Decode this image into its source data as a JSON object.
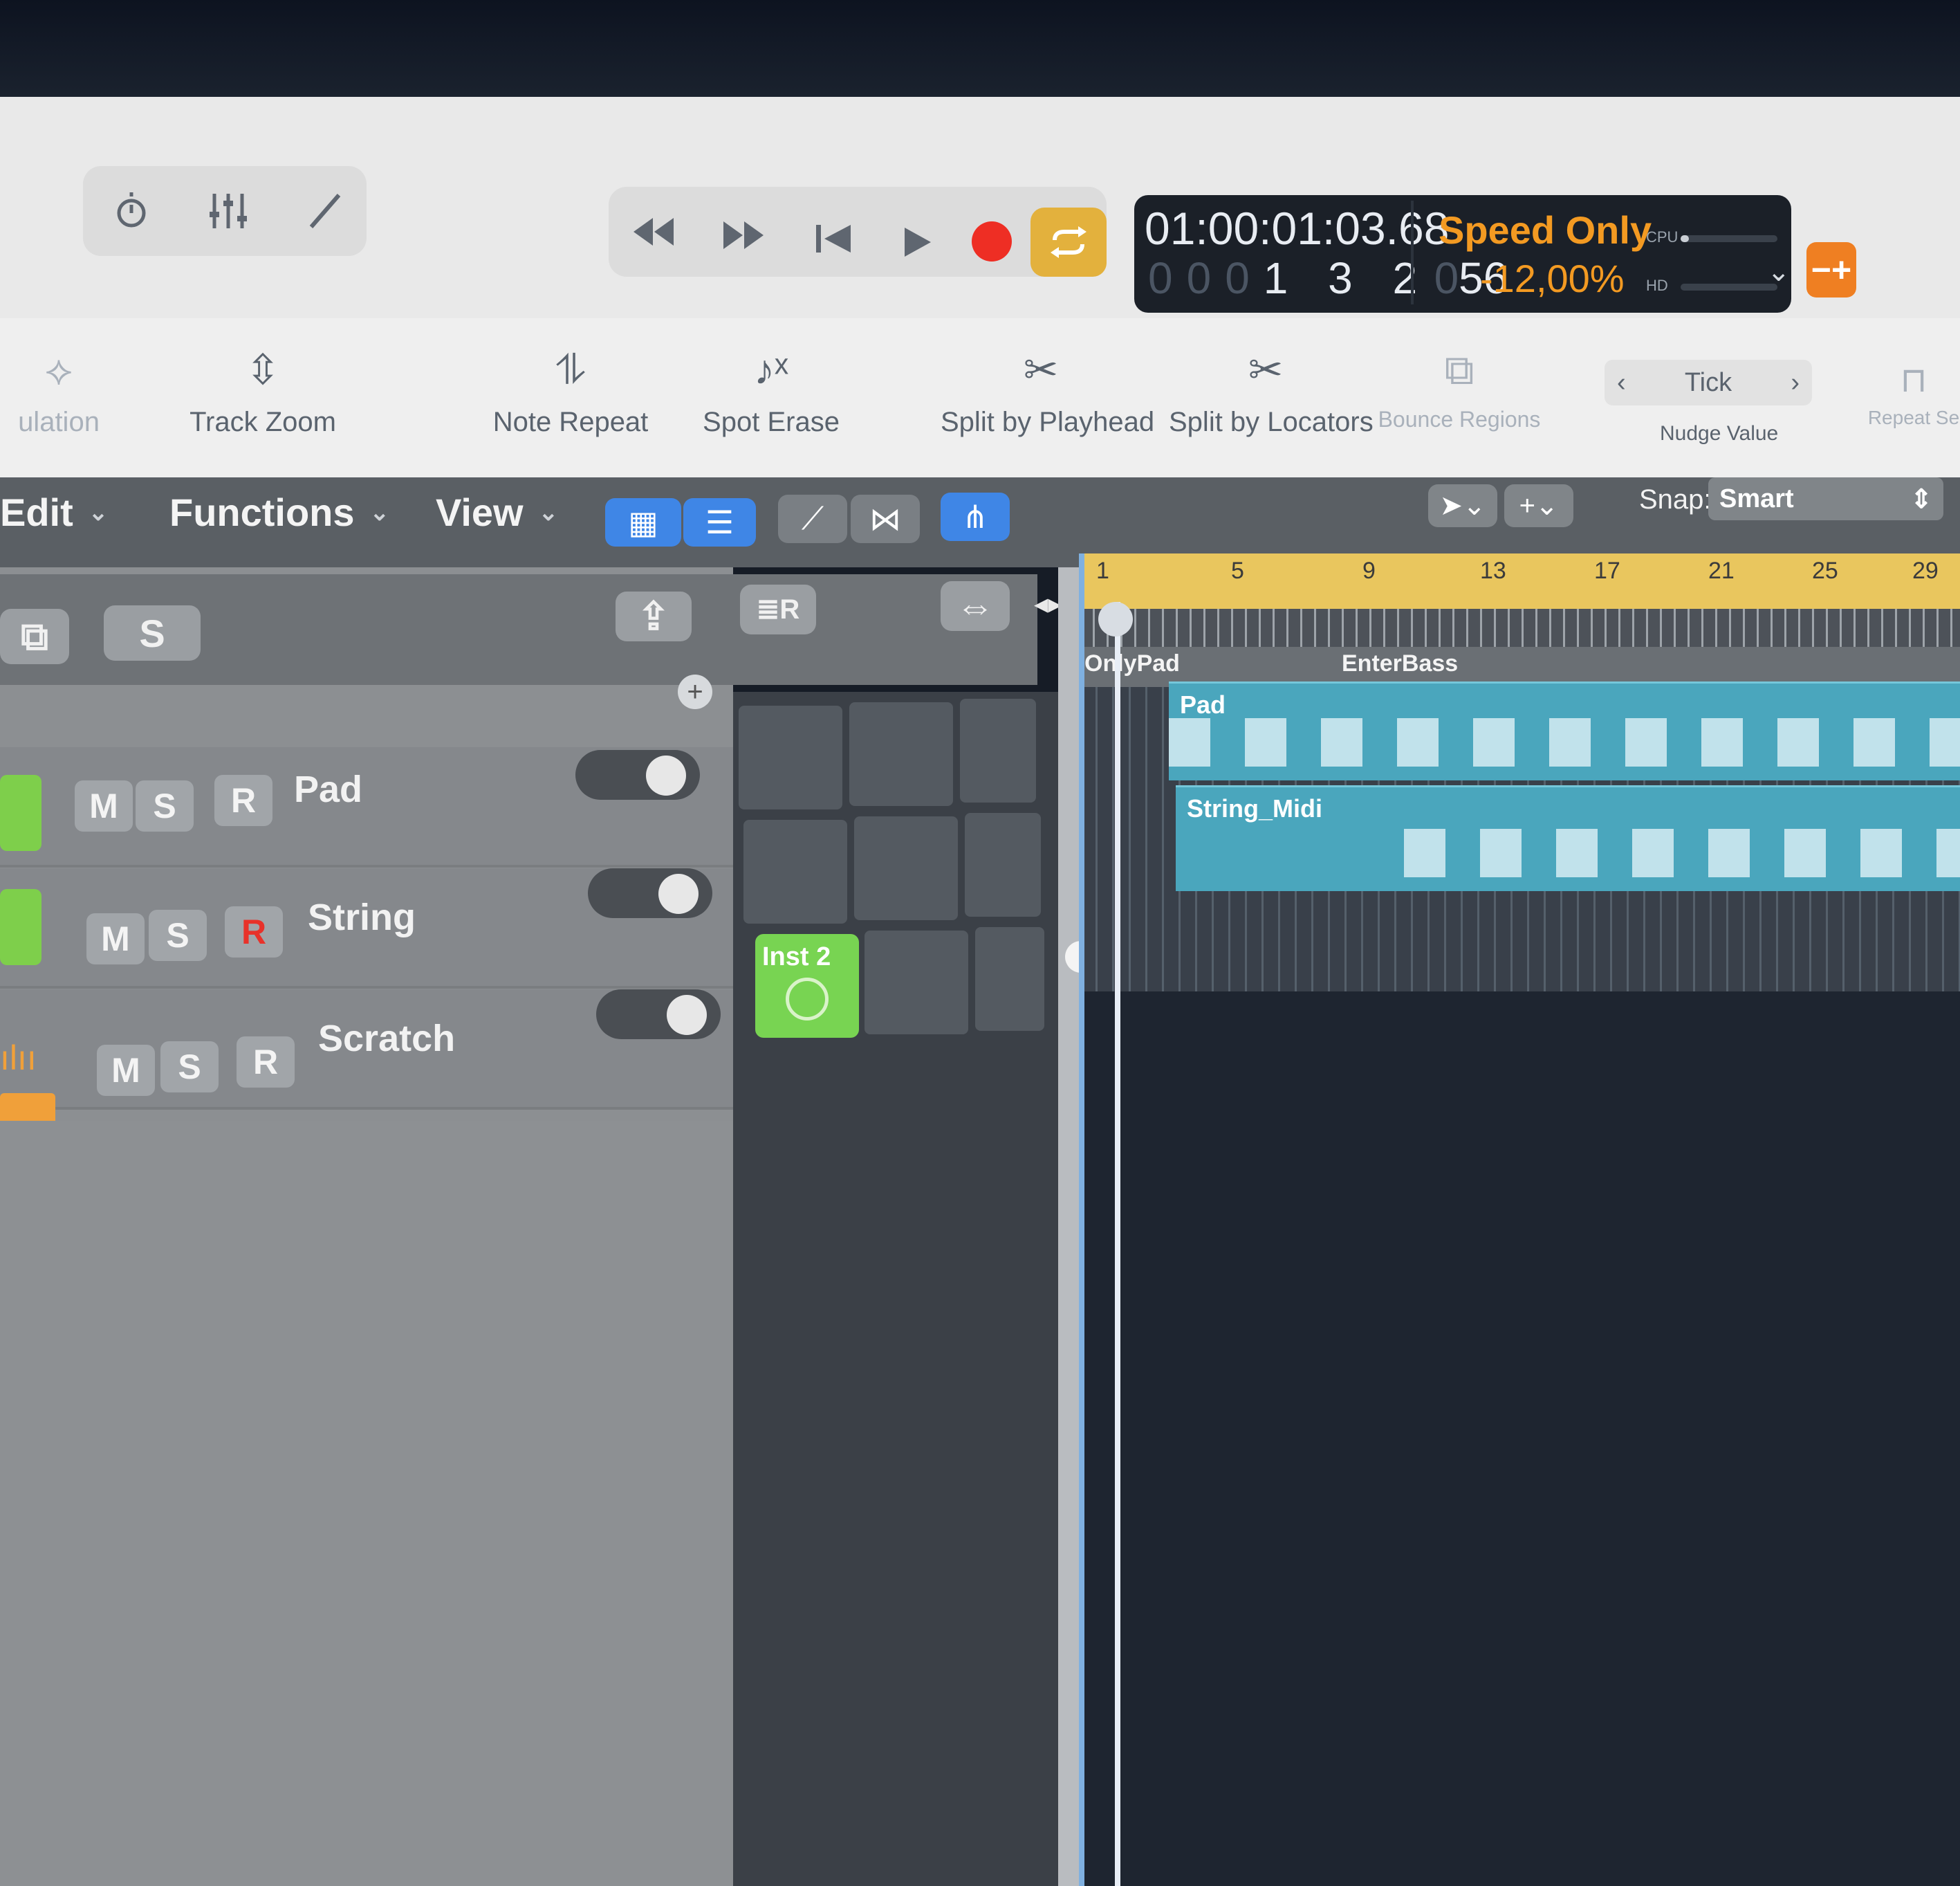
{
  "topbar": {
    "view_buttons": [
      "smart-controls",
      "mixer",
      "editors"
    ],
    "transport": [
      "rewind",
      "fast-forward",
      "go-to-beginning",
      "play",
      "record",
      "cycle"
    ],
    "lcd": {
      "time": "01:00:01:03.68",
      "bars_prefix": "000",
      "bars": "1 3 2",
      "ticks_prefix": "0",
      "ticks": "56",
      "mode": "Speed Only",
      "percent": "-12,00%",
      "cpu_label": "CPU",
      "hd_label": "HD"
    }
  },
  "toolbar": {
    "items": [
      {
        "label": "ulation"
      },
      {
        "label": "Track Zoom"
      },
      {
        "label": "Note Repeat"
      },
      {
        "label": "Spot Erase"
      },
      {
        "label": "Split by Playhead"
      },
      {
        "label": "Split by Locators"
      },
      {
        "label": "Bounce Regions"
      },
      {
        "label": "Repeat Se"
      }
    ],
    "nudge": {
      "value": "Tick",
      "label": "Nudge Value"
    }
  },
  "menubar": {
    "edit": "Edit",
    "functions": "Functions",
    "view": "View",
    "snap_label": "Snap:",
    "snap_value": "Smart"
  },
  "header": {
    "solo_label": "S"
  },
  "tracks": [
    {
      "name": "Pad",
      "m": "M",
      "s": "S",
      "r": "R"
    },
    {
      "name": "String",
      "m": "M",
      "s": "S",
      "r": "R"
    },
    {
      "name": "Scratch",
      "m": "M",
      "s": "S",
      "r": "R"
    }
  ],
  "cells": {
    "inst2": "Inst 2"
  },
  "ruler": {
    "numbers": [
      "1",
      "5",
      "9",
      "13",
      "17",
      "21",
      "25",
      "29"
    ]
  },
  "markers": [
    "OnlyPad",
    "EnterBass"
  ],
  "regions": {
    "pad": "Pad",
    "string": "String_Midi"
  },
  "colors": {
    "accent_blue": "#3f86e6",
    "region": "#4aa6bd",
    "ruler": "#e9c65e",
    "cell_green": "#78d452",
    "lcd_orange": "#f39a22"
  }
}
